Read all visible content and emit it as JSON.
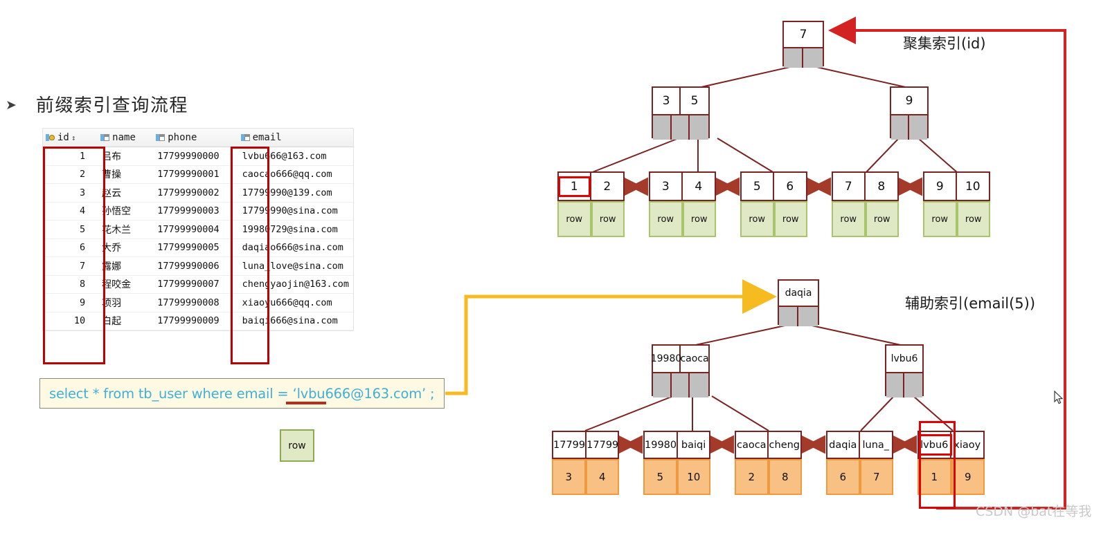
{
  "heading": {
    "bullet": "➤",
    "text": "前缀索引查询流程"
  },
  "table": {
    "columns": [
      {
        "key": "id",
        "label": "id",
        "icon": "primary-key-icon",
        "sort": "↕"
      },
      {
        "key": "name",
        "label": "name",
        "icon": "column-icon",
        "sort": ""
      },
      {
        "key": "phone",
        "label": "phone",
        "icon": "column-icon",
        "sort": ""
      },
      {
        "key": "email",
        "label": "email",
        "icon": "column-icon",
        "sort": ""
      }
    ],
    "rows": [
      {
        "id": "1",
        "name": "吕布",
        "phone": "17799990000",
        "email": "lvbu666@163.com"
      },
      {
        "id": "2",
        "name": "曹操",
        "phone": "17799990001",
        "email": "caocao666@qq.com"
      },
      {
        "id": "3",
        "name": "赵云",
        "phone": "17799990002",
        "email": "17799990@139.com"
      },
      {
        "id": "4",
        "name": "孙悟空",
        "phone": "17799990003",
        "email": "17799990@sina.com"
      },
      {
        "id": "5",
        "name": "花木兰",
        "phone": "17799990004",
        "email": "19980729@sina.com"
      },
      {
        "id": "6",
        "name": "大乔",
        "phone": "17799990005",
        "email": "daqiao666@sina.com"
      },
      {
        "id": "7",
        "name": "露娜",
        "phone": "17799990006",
        "email": "luna_love@sina.com"
      },
      {
        "id": "8",
        "name": "程咬金",
        "phone": "17799990007",
        "email": "chengyaojin@163.com"
      },
      {
        "id": "9",
        "name": "项羽",
        "phone": "17799990008",
        "email": "xiaoyu666@qq.com"
      },
      {
        "id": "10",
        "name": "白起",
        "phone": "17799990009",
        "email": "baiqi666@sina.com"
      }
    ]
  },
  "sql": {
    "text": "select * from tb_user where email = ‘lvbu666@163.com’ ;"
  },
  "standalone_row": {
    "label": "row"
  },
  "labels": {
    "clustered_index": "聚集索引(id)",
    "secondary_index": "辅助索引(email(5))"
  },
  "clustered_tree": {
    "root": {
      "keys": [
        "7"
      ],
      "pointers": 2
    },
    "level2": [
      {
        "keys": [
          "3",
          "5"
        ],
        "pointers": 3
      },
      {
        "keys": [
          "9"
        ],
        "pointers": 2
      }
    ],
    "leaves": [
      {
        "keys": [
          "1",
          "2"
        ],
        "rows": [
          "row",
          "row"
        ]
      },
      {
        "keys": [
          "3",
          "4"
        ],
        "rows": [
          "row",
          "row"
        ]
      },
      {
        "keys": [
          "5",
          "6"
        ],
        "rows": [
          "row",
          "row"
        ]
      },
      {
        "keys": [
          "7",
          "8"
        ],
        "rows": [
          "row",
          "row"
        ]
      },
      {
        "keys": [
          "9",
          "10"
        ],
        "rows": [
          "row",
          "row"
        ]
      }
    ],
    "highlighted_key": "1"
  },
  "secondary_tree": {
    "root": {
      "keys": [
        "daqia"
      ],
      "pointers": 2
    },
    "level2": [
      {
        "keys": [
          "19980",
          "caoca"
        ],
        "pointers": 3
      },
      {
        "keys": [
          "lvbu6"
        ],
        "pointers": 2
      }
    ],
    "leaves": [
      {
        "keys": [
          "17799",
          "17799"
        ],
        "rows": [
          "3",
          "4"
        ]
      },
      {
        "keys": [
          "19980",
          "baiqi"
        ],
        "rows": [
          "5",
          "10"
        ]
      },
      {
        "keys": [
          "caoca",
          "cheng"
        ],
        "rows": [
          "2",
          "8"
        ]
      },
      {
        "keys": [
          "daqia",
          "luna_"
        ],
        "rows": [
          "6",
          "7"
        ]
      },
      {
        "keys": [
          "lvbu6",
          "xiaoy"
        ],
        "rows": [
          "1",
          "9"
        ]
      }
    ],
    "highlighted_key": "lvbu6",
    "highlighted_row": "1"
  },
  "colors": {
    "tree_border": "#7b2222",
    "pointer_fill": "#c0c0c0",
    "row_green": "#dfe9c6",
    "row_orange": "#f8c183",
    "highlight_red": "#e30000",
    "lookup_arrow_red": "#d22222",
    "query_arrow_yellow": "#f5bb20",
    "sql_text": "#41b0d4",
    "sql_bg": "#fdf9e3"
  },
  "watermark": {
    "text": "CSDN @bat在等我"
  }
}
